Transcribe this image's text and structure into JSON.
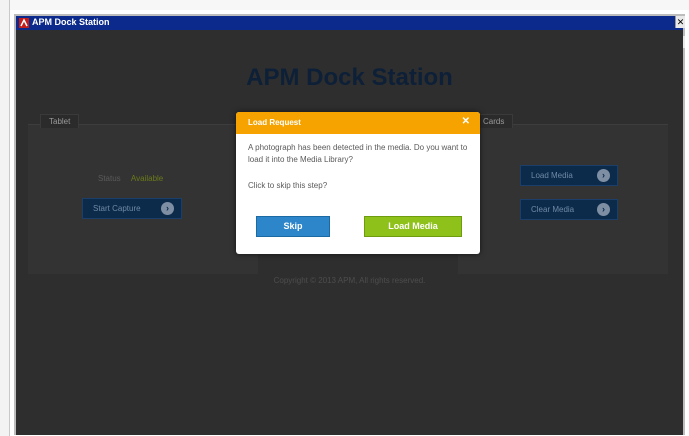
{
  "window": {
    "title": "APM Dock Station",
    "close_glyph": "✕",
    "restore_glyph": "□"
  },
  "app": {
    "heading": "APM Dock Station",
    "left_tab": "Tablet",
    "right_tab": "Cards",
    "status_label": "Status",
    "status_value": "Available",
    "left_button_label": "Start Capture",
    "right_button_1_label": "Load Media",
    "right_button_2_label": "Clear Media",
    "copyright": "Copyright © 2013 APM, All rights reserved."
  },
  "dialog": {
    "title": "Load Request",
    "close_glyph": "✕",
    "message": "A photograph has been detected in the media. Do you want to load it into the Media Library?",
    "question": "Click to skip this step?",
    "skip_label": "Skip",
    "load_label": "Load Media"
  },
  "colors": {
    "accent_orange": "#f6a300",
    "skip_blue": "#2d86c9",
    "load_green": "#8ec21a",
    "titlebar_blue": "#0b2a8c"
  },
  "icons": {
    "app": "apm-logo-icon",
    "arrow": "arrow-right-circle-icon"
  }
}
